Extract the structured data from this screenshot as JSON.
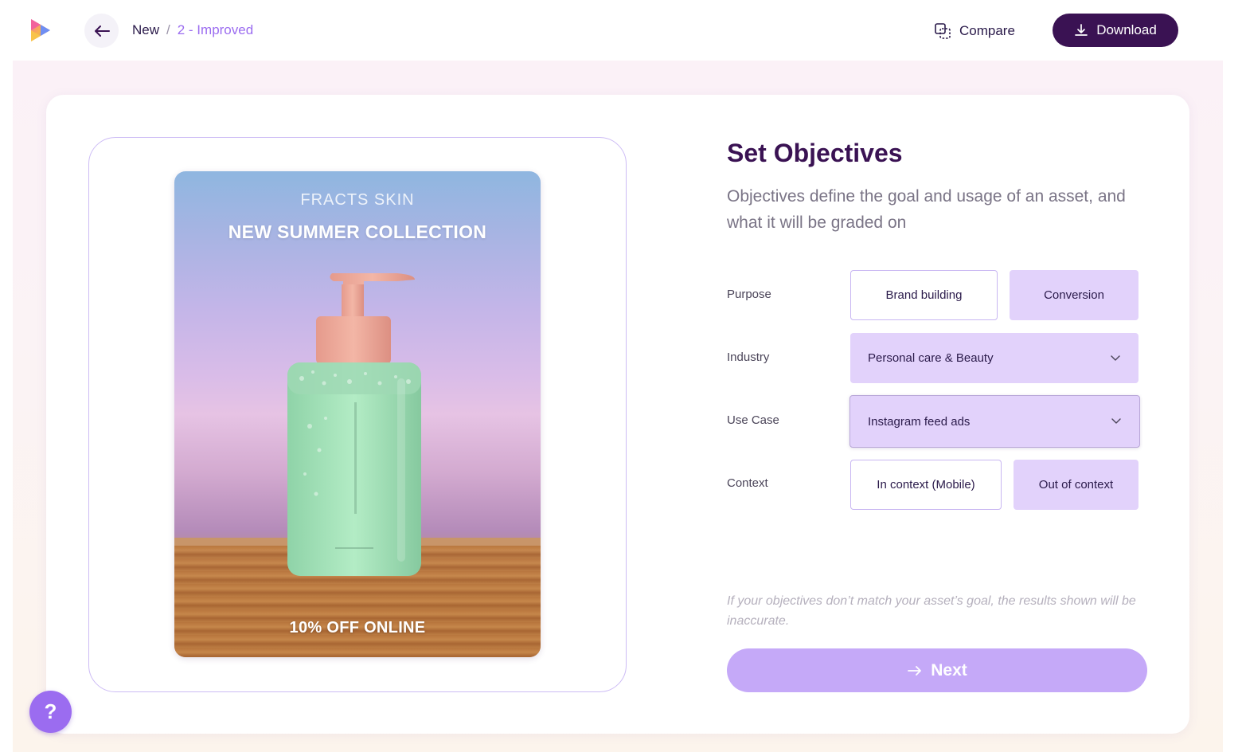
{
  "header": {
    "breadcrumb_root": "New",
    "breadcrumb_separator": "/",
    "breadcrumb_current": "2 - Improved",
    "compare_label": "Compare",
    "download_label": "Download"
  },
  "asset": {
    "brand": "FRACTS SKIN",
    "headline": "NEW SUMMER COLLECTION",
    "offer": "10% OFF ONLINE"
  },
  "objectives": {
    "title": "Set Objectives",
    "description": "Objectives define the goal and usage of an asset, and what it will be graded on",
    "purpose": {
      "label": "Purpose",
      "options": [
        "Brand building",
        "Conversion"
      ],
      "selected": "Conversion"
    },
    "industry": {
      "label": "Industry",
      "value": "Personal care & Beauty"
    },
    "use_case": {
      "label": "Use Case",
      "value": "Instagram feed ads"
    },
    "context": {
      "label": "Context",
      "options": [
        "In context (Mobile)",
        "Out of context"
      ],
      "selected": "Out of context"
    },
    "warning": "If your objectives don’t match your asset’s goal, the results shown will be inaccurate.",
    "next_label": "Next"
  },
  "help": {
    "label": "?"
  },
  "colors": {
    "brand_dark": "#3a1253",
    "accent": "#9b6cf0",
    "selected_bg": "#e2d2fb",
    "next_bg": "#c5a9f8"
  }
}
